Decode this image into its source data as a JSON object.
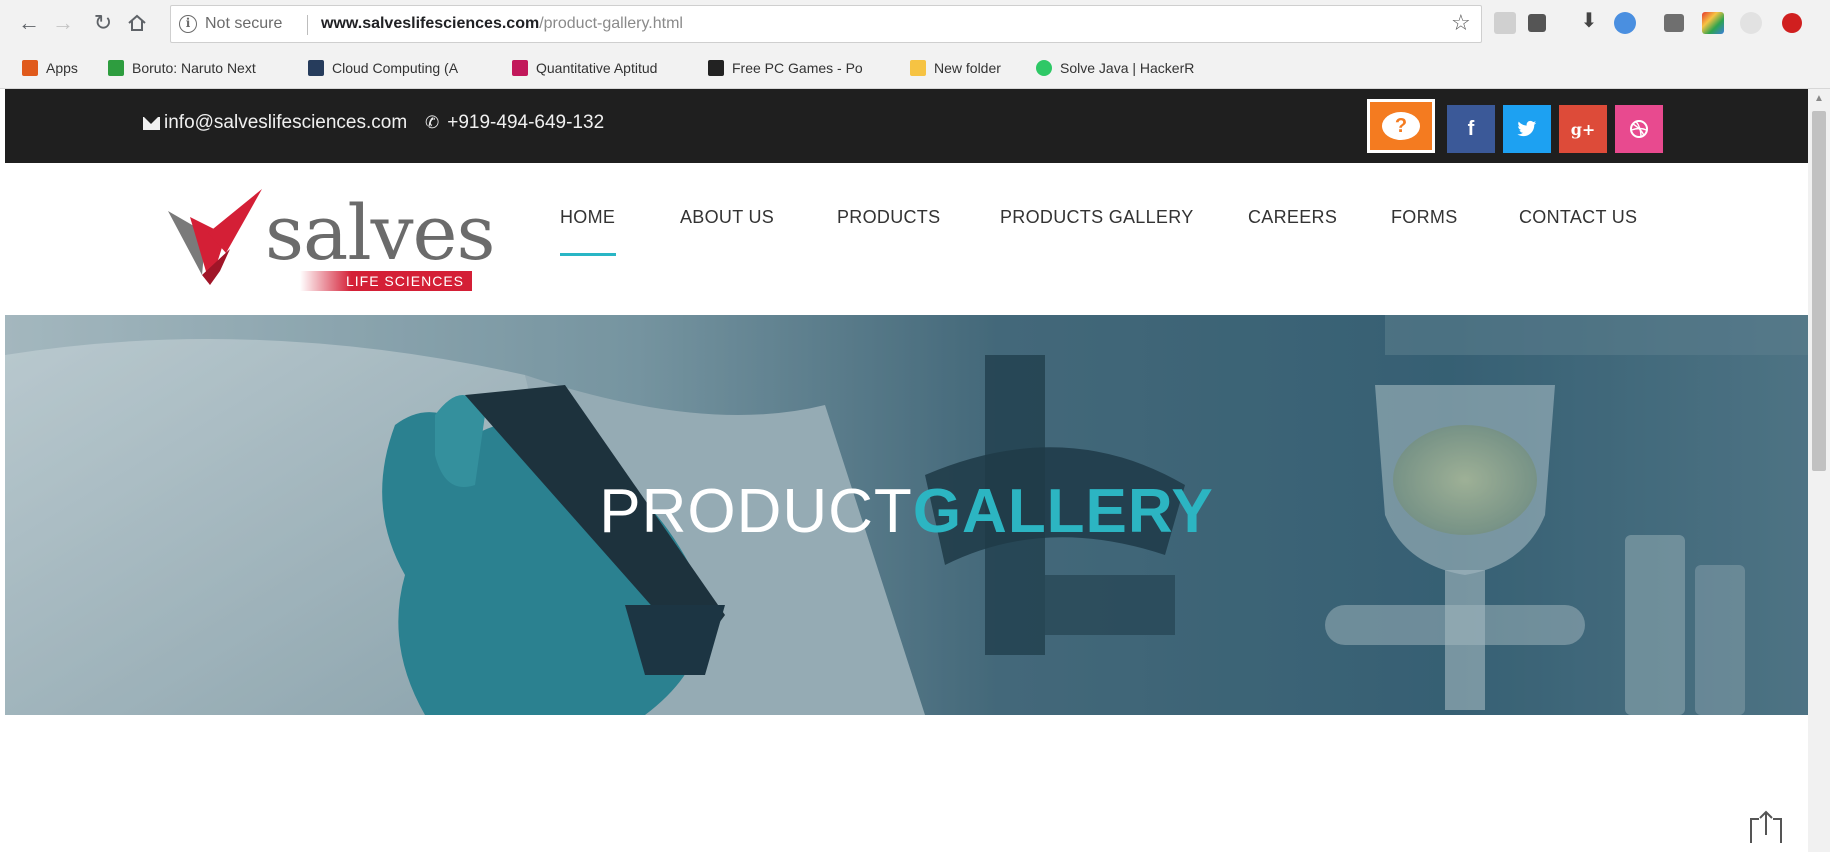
{
  "browser": {
    "security_label": "Not secure",
    "url_host": "www.salveslifesciences.com",
    "url_path": "/product-gallery.html",
    "bookmarks": [
      {
        "label": "Apps",
        "color": "#e05a1c"
      },
      {
        "label": "Boruto: Naruto Next",
        "color": "#2e9d3f"
      },
      {
        "label": "Cloud Computing (A",
        "color": "#263c5c"
      },
      {
        "label": "Quantitative Aptitud",
        "color": "#c2185b"
      },
      {
        "label": "Free PC Games - Po",
        "color": "#222222"
      },
      {
        "label": "New folder",
        "color": "#f6c343"
      },
      {
        "label": "Solve Java | HackerR",
        "color": "#2ec866"
      }
    ]
  },
  "topbar": {
    "email": "info@salveslifesciences.com",
    "phone": "+919-494-649-132",
    "help_symbol": "?",
    "facebook_symbol": "f",
    "google_symbol": "g+"
  },
  "header": {
    "logo_word": "salves",
    "logo_sub": "LIFE SCIENCES",
    "menu": [
      "HOME",
      "ABOUT US",
      "PRODUCTS",
      "PRODUCTS GALLERY",
      "CAREERS",
      "FORMS",
      "CONTACT US"
    ],
    "active_menu": "HOME"
  },
  "hero": {
    "title_light": "PRODUCT",
    "title_bold": "GALLERY"
  },
  "colors": {
    "accent": "#2cb5c2",
    "brand_red": "#d41f36",
    "topbar": "#1f1f1f",
    "help_orange": "#f47b20"
  }
}
